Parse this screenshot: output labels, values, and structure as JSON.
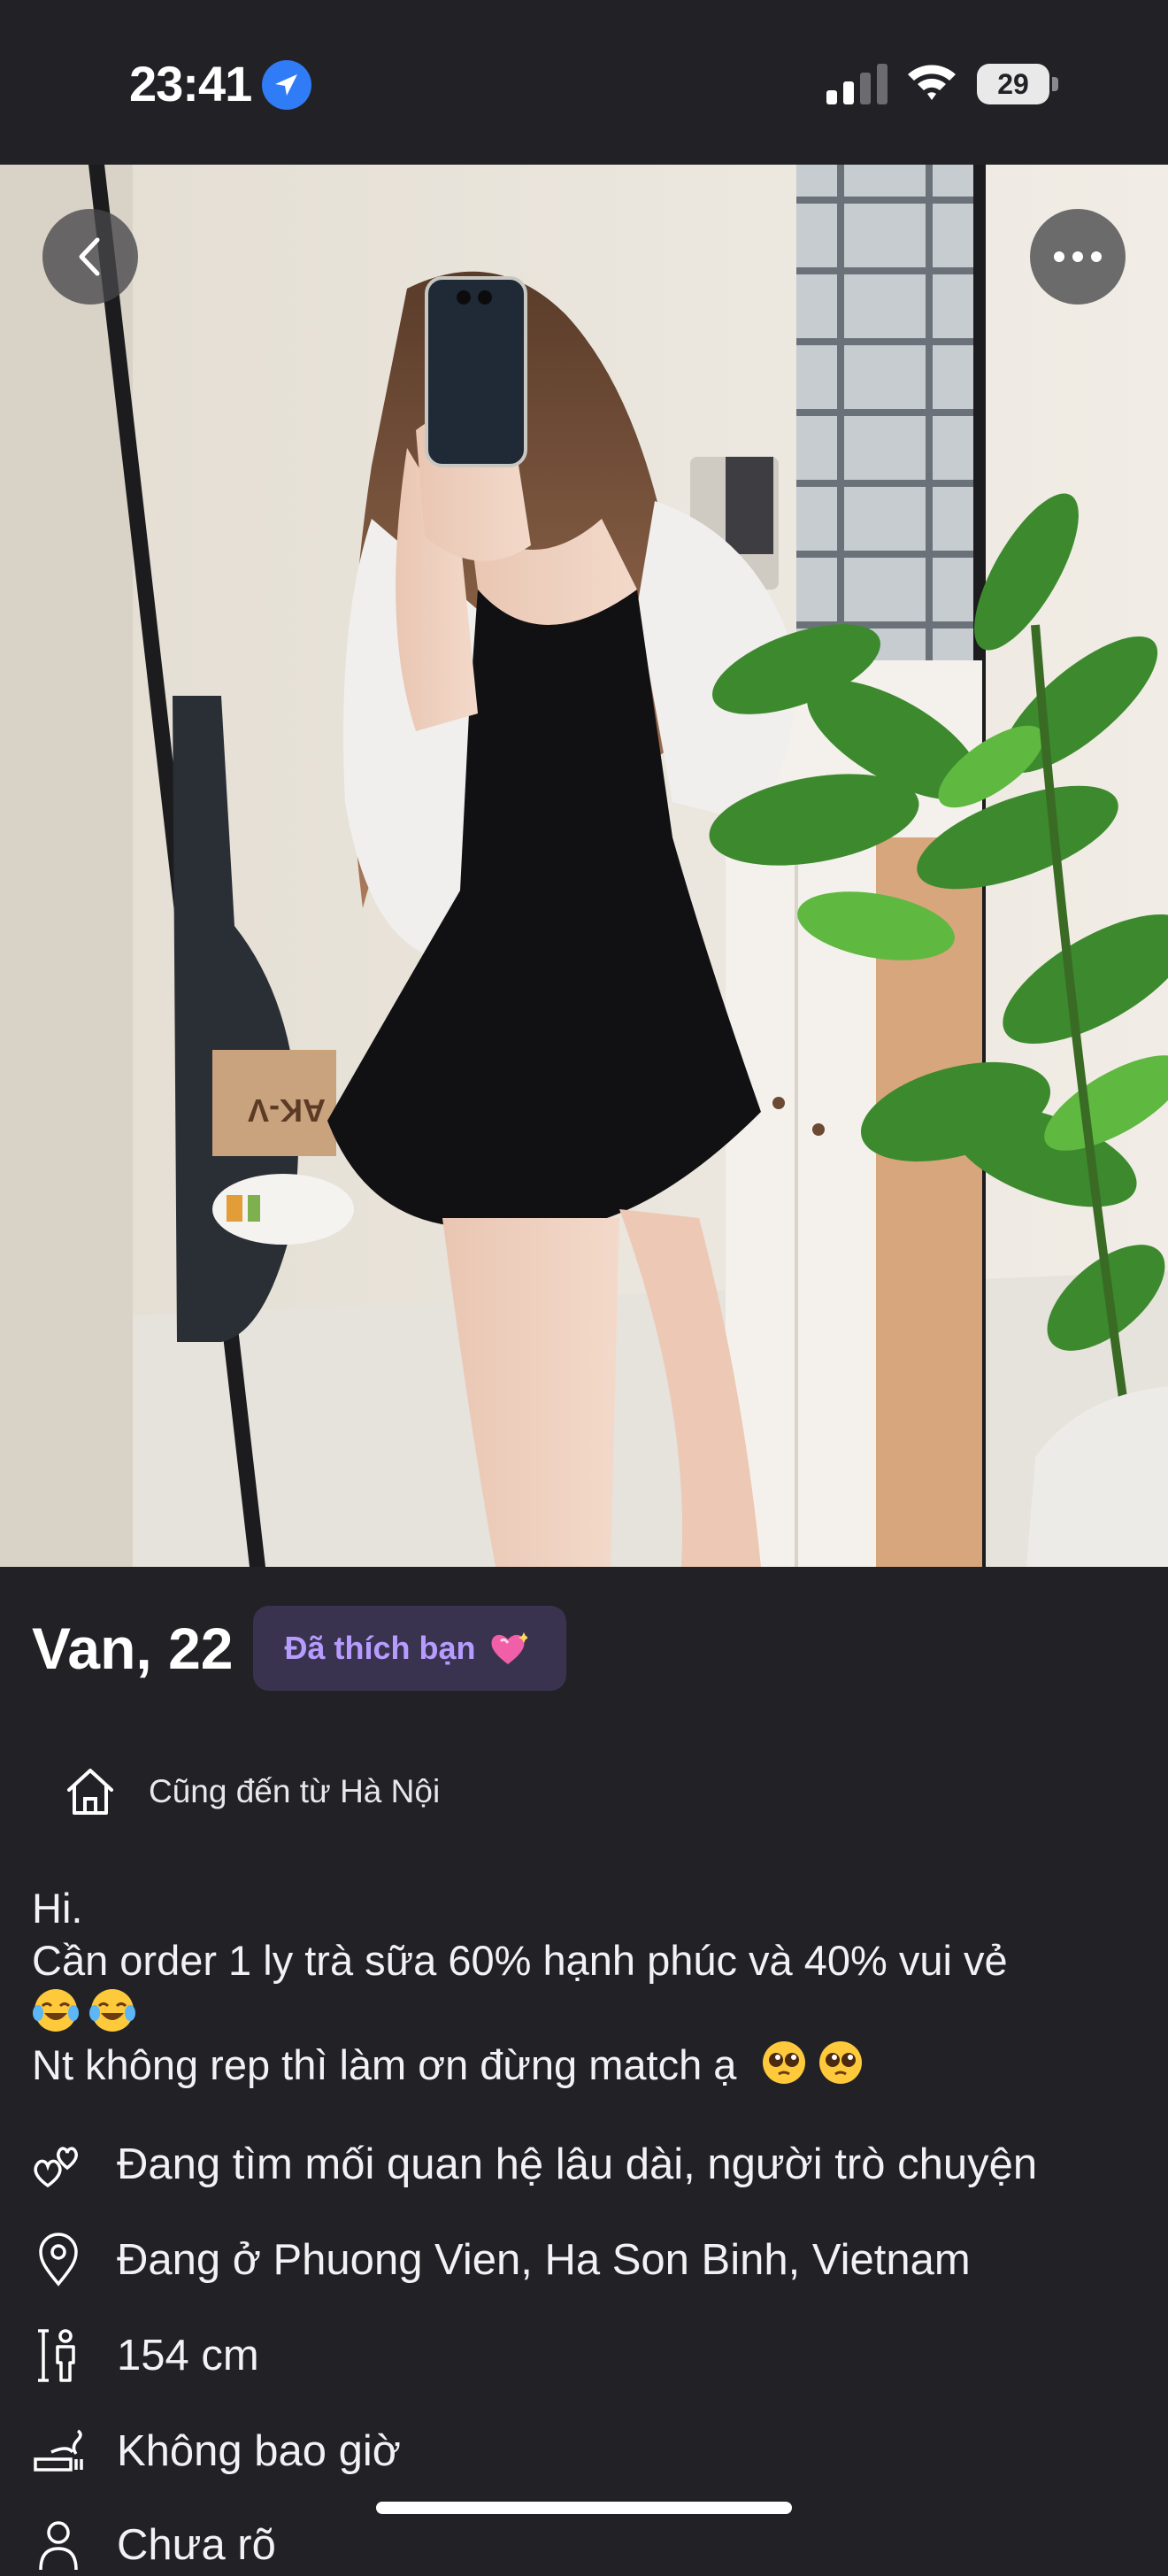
{
  "status_bar": {
    "time": "23:41",
    "battery": "29",
    "battery_level": 0.29,
    "icons": [
      "location-arrow-icon",
      "cellular-signal-icon",
      "wifi-icon",
      "battery-icon"
    ]
  },
  "photo_overlay": {
    "back_icon": "chevron-left-icon",
    "more_icon": "more-horizontal-icon",
    "box_label": "AK-V"
  },
  "profile": {
    "name_age": "Van, 22",
    "liked_badge": "Đã thích bạn",
    "liked_badge_color": "#b79cff",
    "hometown": "Cũng đến từ Hà Nội",
    "bio": {
      "line1": "Hi.",
      "line2": "Cần order 1 ly trà sữa 60% hạnh phúc và 40% vui vẻ",
      "line4": "Nt không rep thì làm ơn đừng match ạ"
    },
    "details": [
      {
        "icon": "hearts-icon",
        "text": "Đang tìm mối quan hệ lâu dài, người trò chuyện"
      },
      {
        "icon": "location-pin-icon",
        "text": "Đang ở Phuong Vien, Ha Son Binh, Vietnam"
      },
      {
        "icon": "height-icon",
        "text": "154 cm"
      },
      {
        "icon": "smoking-icon",
        "text": "Không bao giờ"
      },
      {
        "icon": "person-icon",
        "text": "Chưa rõ"
      }
    ]
  },
  "colors": {
    "background": "#222226",
    "badge_background": "#3a3350"
  }
}
